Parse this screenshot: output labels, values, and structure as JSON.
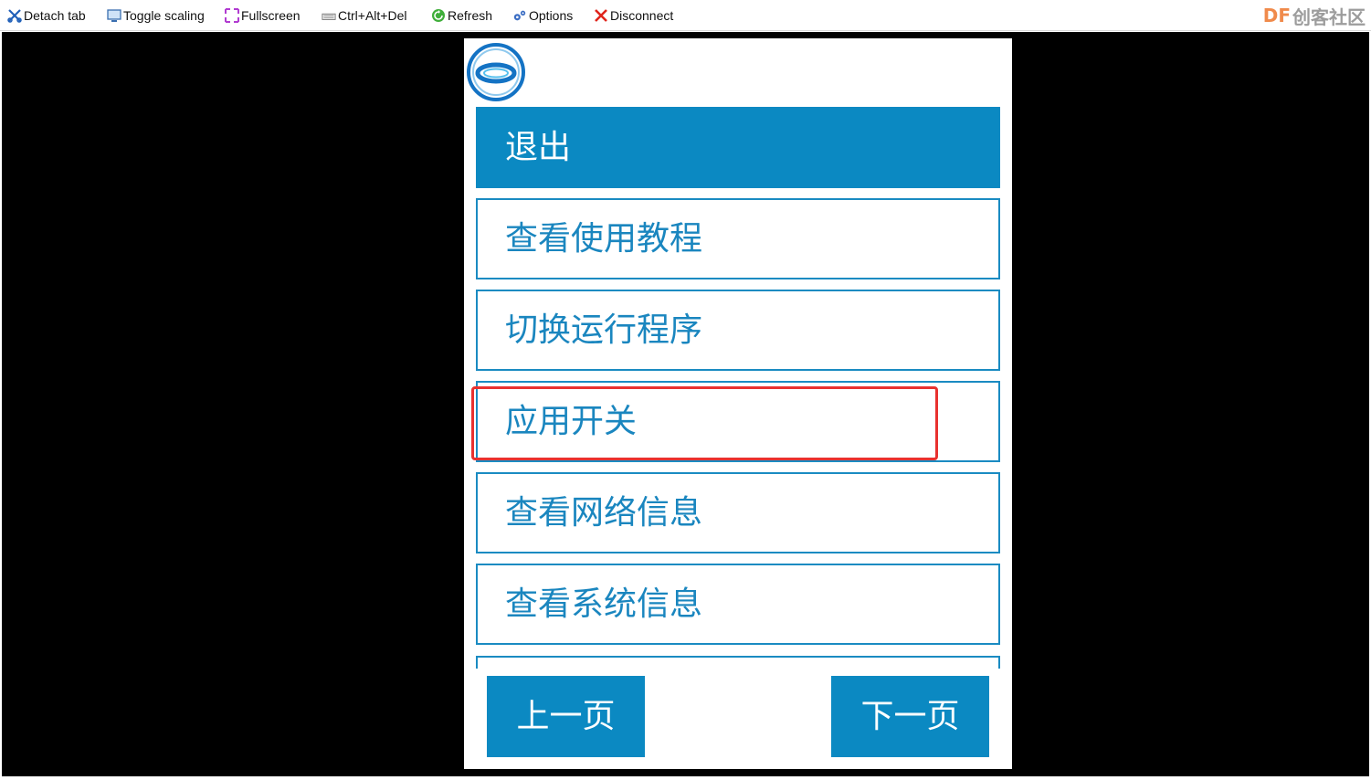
{
  "toolbar": {
    "items": [
      {
        "label": "Detach tab",
        "icon": "scissors-icon"
      },
      {
        "label": "Toggle scaling",
        "icon": "monitor-icon"
      },
      {
        "label": "Fullscreen",
        "icon": "fullscreen-arrows-icon"
      },
      {
        "label": "Ctrl+Alt+Del",
        "icon": "keyboard-icon"
      },
      {
        "label": "Refresh",
        "icon": "refresh-icon"
      },
      {
        "label": "Options",
        "icon": "gears-icon"
      },
      {
        "label": "Disconnect",
        "icon": "red-x-icon"
      }
    ],
    "brand_df": "DF",
    "brand_text": "创客社区"
  },
  "device": {
    "logo": "circle-logo",
    "menu": [
      {
        "label": "退出",
        "active": true
      },
      {
        "label": "查看使用教程",
        "active": false
      },
      {
        "label": "切换运行程序",
        "active": false
      },
      {
        "label": "应用开关",
        "active": false
      },
      {
        "label": "查看网络信息",
        "active": false
      },
      {
        "label": "查看系统信息",
        "active": false
      }
    ],
    "prev_label": "上一页",
    "next_label": "下一页"
  },
  "colors": {
    "accent": "#0b89c2",
    "border": "#1a8bc2",
    "highlight": "#e8312f",
    "brand_orange": "#f08a4b"
  }
}
